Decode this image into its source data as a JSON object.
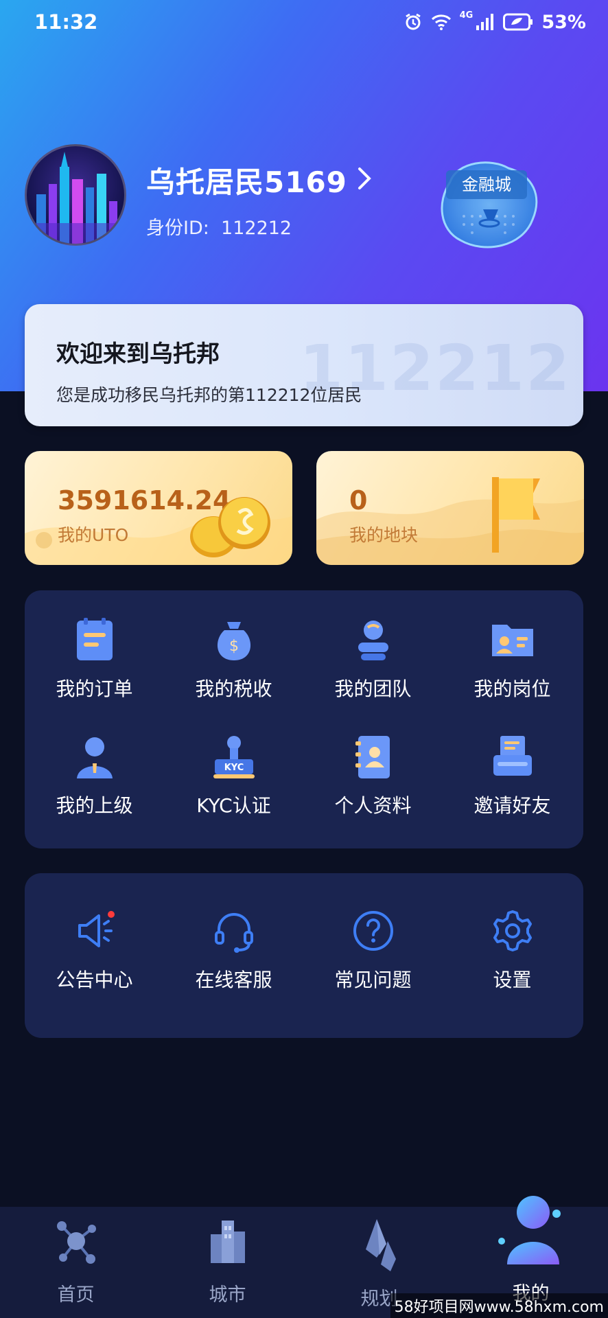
{
  "status_bar": {
    "time": "11:32",
    "battery": "53%",
    "network": "4G"
  },
  "profile": {
    "name": "乌托居民5169",
    "id_label": "身份ID:",
    "id_value": "112212",
    "city_label": "金融城"
  },
  "welcome": {
    "title": "欢迎来到乌托邦",
    "subtitle": "您是成功移民乌托邦的第112212位居民",
    "watermark": "112212"
  },
  "assets": {
    "uto": {
      "value": "3591614.24",
      "label": "我的UTO"
    },
    "land": {
      "value": "0",
      "label": "我的地块"
    }
  },
  "grid_menu": [
    {
      "label": "我的订单",
      "icon": "order-icon"
    },
    {
      "label": "我的税收",
      "icon": "tax-bag-icon"
    },
    {
      "label": "我的团队",
      "icon": "team-icon"
    },
    {
      "label": "我的岗位",
      "icon": "position-card-icon"
    },
    {
      "label": "我的上级",
      "icon": "superior-icon"
    },
    {
      "label": "KYC认证",
      "icon": "kyc-stamp-icon",
      "icon_text": "KYC"
    },
    {
      "label": "个人资料",
      "icon": "profile-book-icon"
    },
    {
      "label": "邀请好友",
      "icon": "invite-printer-icon"
    }
  ],
  "services": [
    {
      "label": "公告中心",
      "icon": "megaphone-icon"
    },
    {
      "label": "在线客服",
      "icon": "headset-icon"
    },
    {
      "label": "常见问题",
      "icon": "question-icon"
    },
    {
      "label": "设置",
      "icon": "gear-icon"
    }
  ],
  "bottom_nav": [
    {
      "label": "首页",
      "icon": "home-molecule-icon",
      "active": false
    },
    {
      "label": "城市",
      "icon": "city-buildings-icon",
      "active": false
    },
    {
      "label": "规划",
      "icon": "plan-crystal-icon",
      "active": false
    },
    {
      "label": "我的",
      "icon": "me-avatar-icon",
      "active": true
    }
  ],
  "corner_watermark": "58好项目网www.58hxm.com",
  "colors": {
    "accent": "#3e6cf3",
    "panel": "#1a2450",
    "gold_text": "#b8611a",
    "service_icon": "#3e7ef5",
    "notification_dot": "#ff3b3b"
  }
}
